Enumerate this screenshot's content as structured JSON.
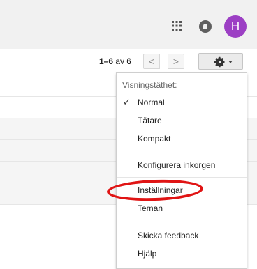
{
  "header": {
    "apps_icon": "apps-grid-icon",
    "notifications_icon": "notifications-icon",
    "avatar_letter": "H",
    "avatar_color": "#9c3fc4"
  },
  "toolbar": {
    "page_range": "1–6",
    "page_of": "av",
    "page_total": "6",
    "prev_label": "<",
    "next_label": ">",
    "settings_icon": "gear-icon"
  },
  "settings_menu": {
    "density_header": "Visningstäthet:",
    "density_options": [
      {
        "label": "Normal",
        "checked": true
      },
      {
        "label": "Tätare",
        "checked": false
      },
      {
        "label": "Kompakt",
        "checked": false
      }
    ],
    "configure_inbox": "Konfigurera inkorgen",
    "settings": "Inställningar",
    "themes": "Teman",
    "send_feedback": "Skicka feedback",
    "help": "Hjälp"
  },
  "annotation": {
    "highlight_color": "#e01414"
  }
}
